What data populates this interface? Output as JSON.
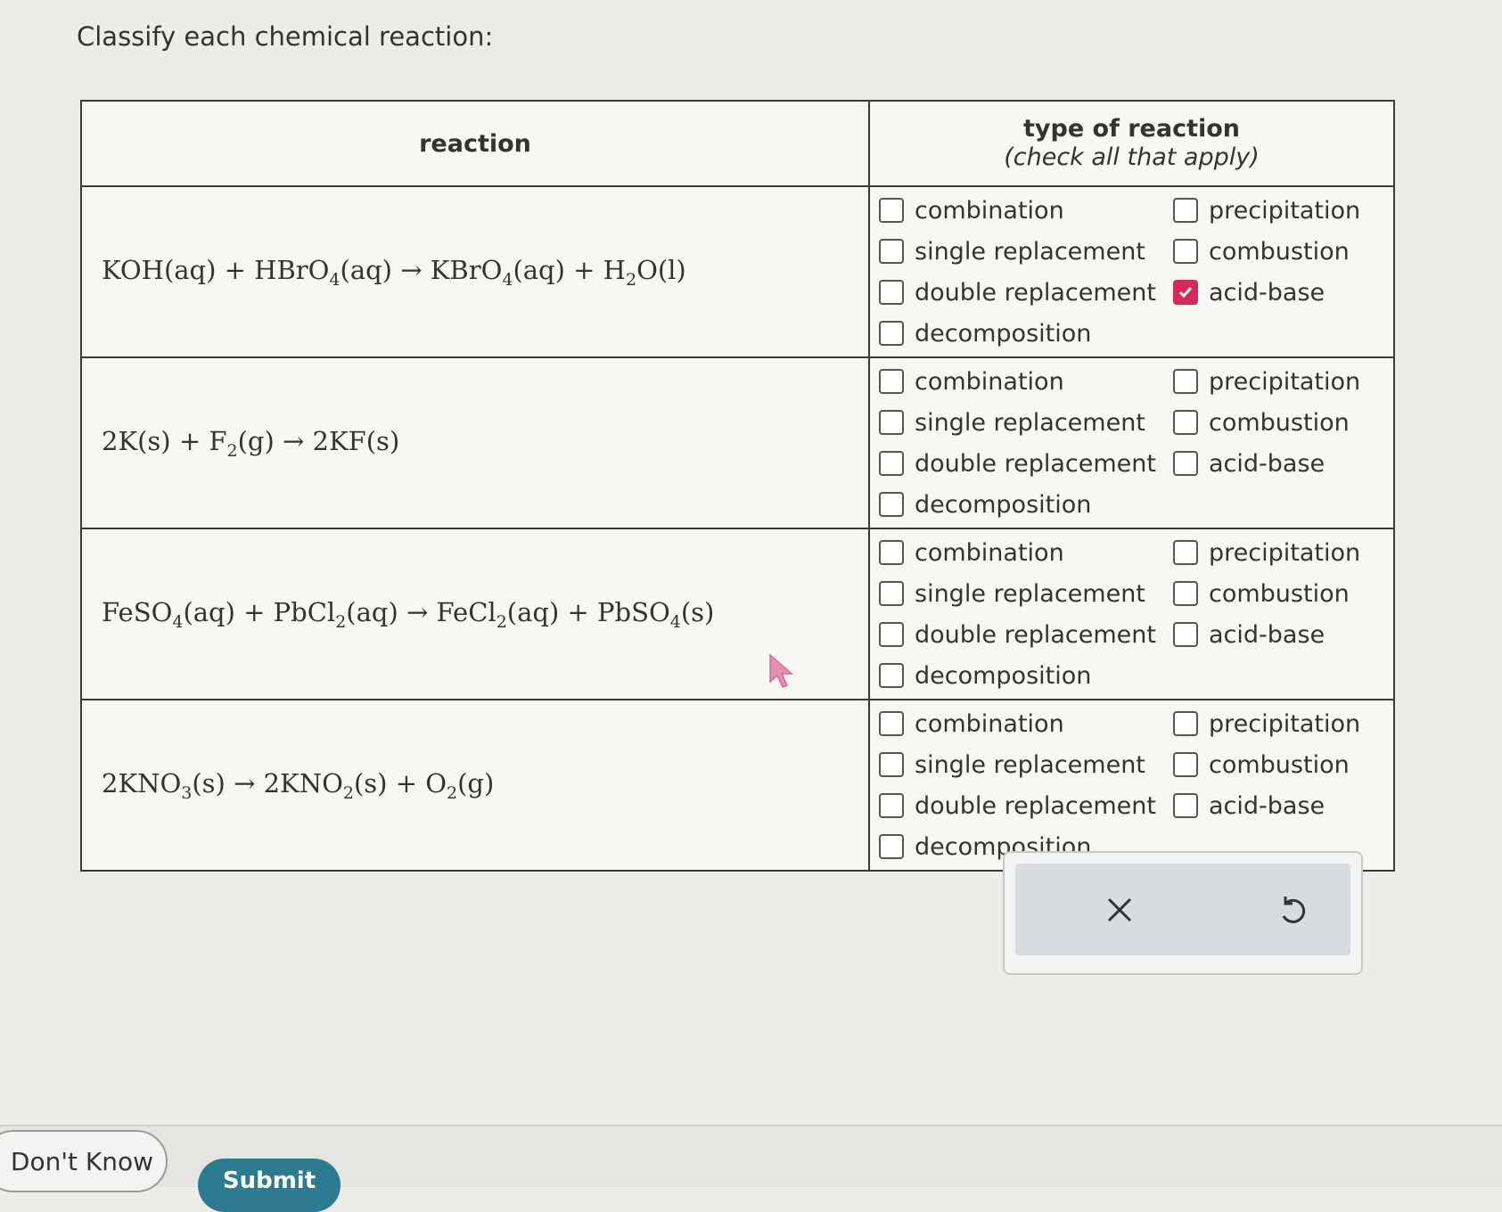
{
  "prompt": "Classify each chemical reaction:",
  "table": {
    "header_reaction": "reaction",
    "header_type": "type of reaction",
    "header_type_sub": "(check all that apply)"
  },
  "option_labels": {
    "combination": "combination",
    "single_replacement": "single replacement",
    "double_replacement": "double replacement",
    "decomposition": "decomposition",
    "precipitation": "precipitation",
    "combustion": "combustion",
    "acid_base": "acid-base"
  },
  "reactions": [
    {
      "equation": "KOH(aq) + HBrO4(aq) → KBrO4(aq) + H2O(l)",
      "checked": {
        "combination": false,
        "single_replacement": false,
        "double_replacement": false,
        "decomposition": false,
        "precipitation": false,
        "combustion": false,
        "acid_base": true
      }
    },
    {
      "equation": "2K(s) + F2(g) → 2KF(s)",
      "checked": {
        "combination": false,
        "single_replacement": false,
        "double_replacement": false,
        "decomposition": false,
        "precipitation": false,
        "combustion": false,
        "acid_base": false
      }
    },
    {
      "equation": "FeSO4(aq) + PbCl2(aq) → FeCl2(aq) + PbSO4(s)",
      "checked": {
        "combination": false,
        "single_replacement": false,
        "double_replacement": false,
        "decomposition": false,
        "precipitation": false,
        "combustion": false,
        "acid_base": false
      }
    },
    {
      "equation": "2KNO3(s) → 2KNO2(s) + O2(g)",
      "checked": {
        "combination": false,
        "single_replacement": false,
        "double_replacement": false,
        "decomposition": false,
        "precipitation": false,
        "combustion": false,
        "acid_base": false
      }
    }
  ],
  "actions": {
    "clear_icon": "x-icon",
    "undo_icon": "undo-icon"
  },
  "footer": {
    "dont_know": "Don't Know",
    "submit": "Submit"
  },
  "colors": {
    "check_accent": "#d6285c",
    "submit_bg": "#2c7b8e"
  }
}
